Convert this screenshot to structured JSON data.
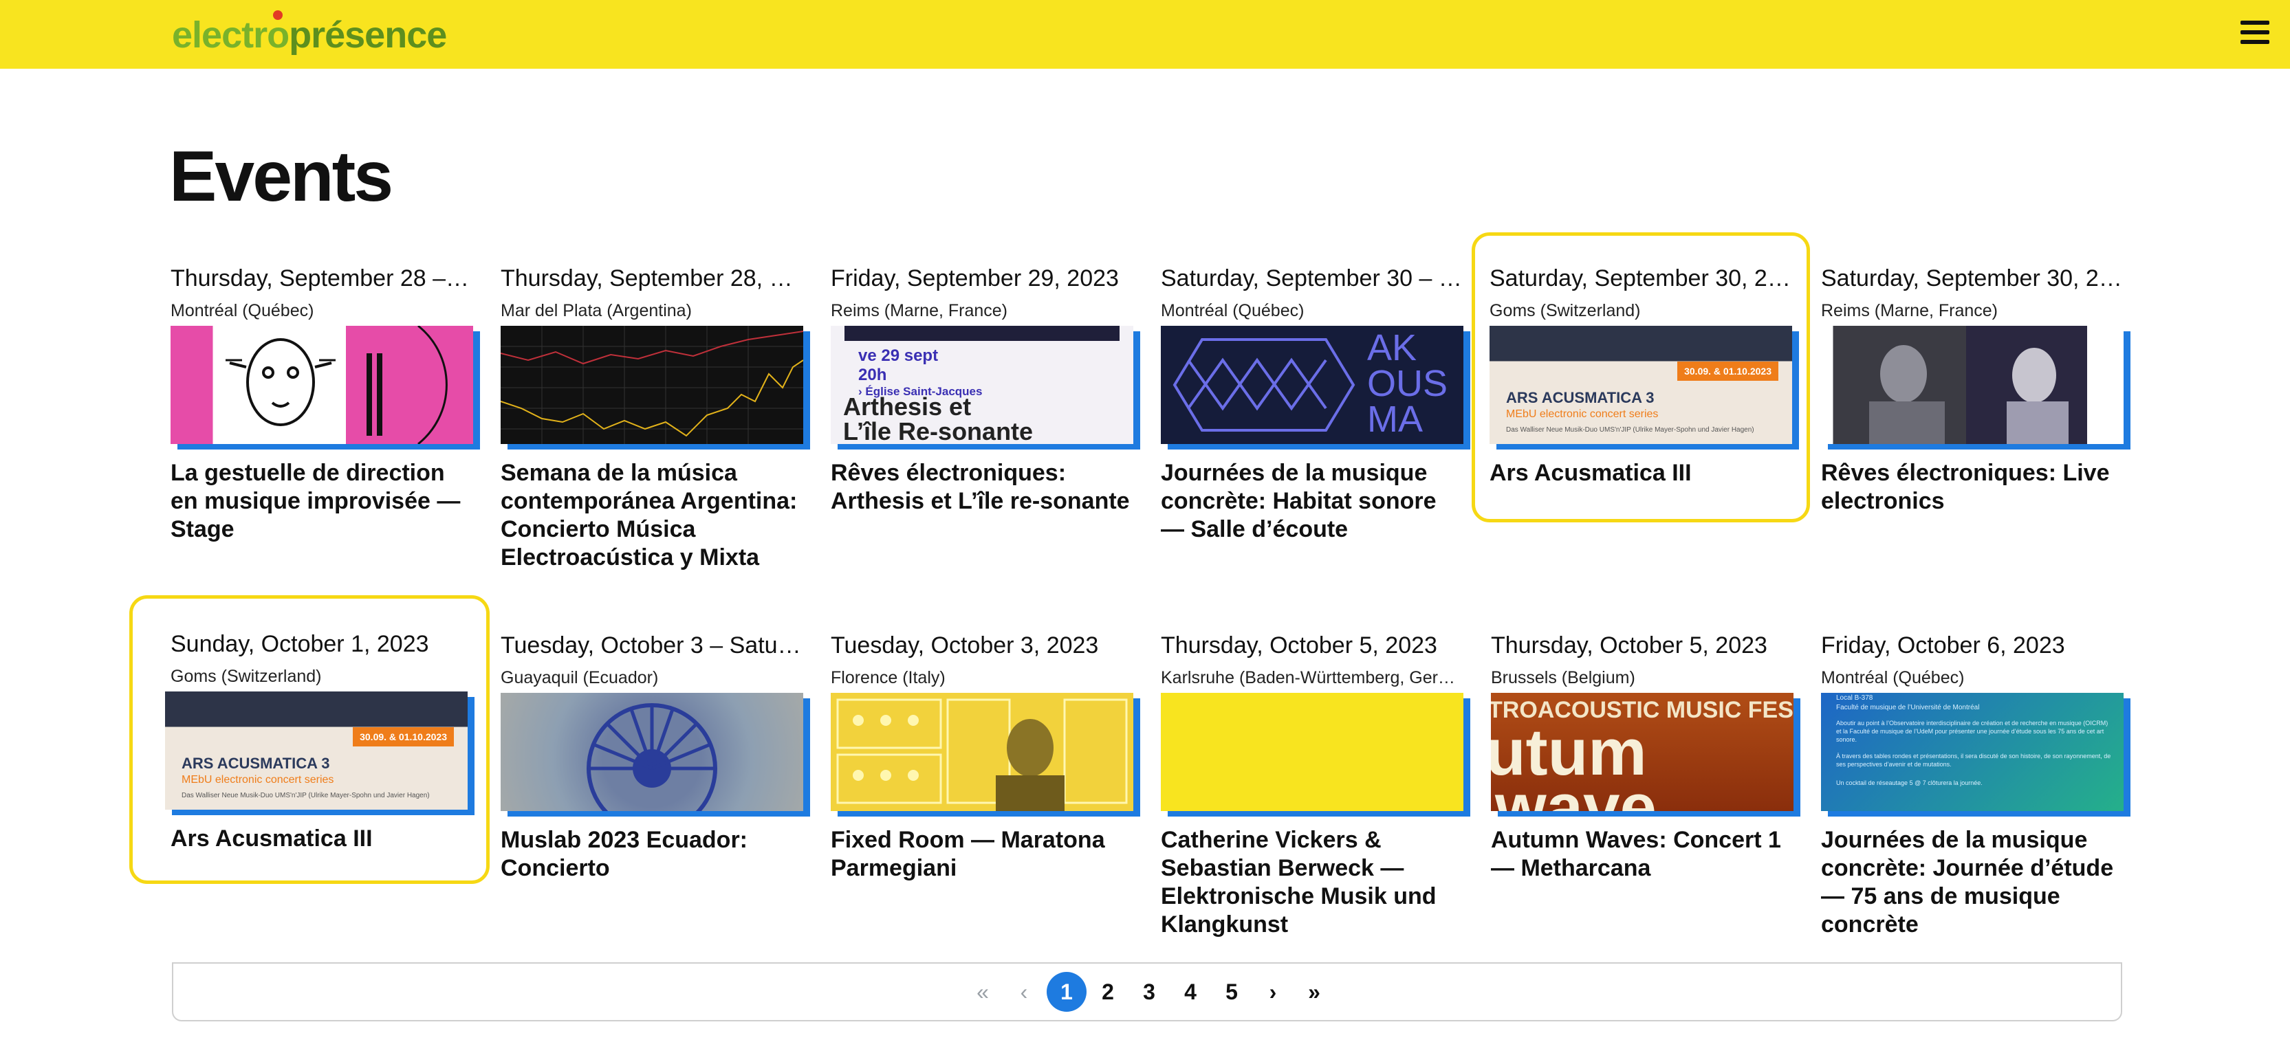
{
  "header": {
    "logo": "electroprésence",
    "menu_icon": "hamburger-menu-icon"
  },
  "page_title": "Events",
  "events": [
    {
      "date": "Thursday, September 28 – …",
      "location": "Montréal (Québec)",
      "title": "La gestuelle de direction en musique improvisée — Stage"
    },
    {
      "date": "Thursday, September 28, 2…",
      "location": "Mar del Plata (Argentina)",
      "title": "Semana de la música contemporánea Argentina: Concierto Música Electroacústica y Mixta"
    },
    {
      "date": "Friday, September 29, 2023",
      "location": "Reims (Marne, France)",
      "title": "Rêves électroniques: Arthesis et L’île re-sonante",
      "image_text": {
        "line1": "ve 29 sept",
        "line2": "20h",
        "line3": "› Église Saint-Jacques",
        "line4": "Arthesis et",
        "line5": "L’île Re-sonante"
      }
    },
    {
      "date": "Saturday, September 30 – …",
      "location": "Montréal (Québec)",
      "title": "Journées de la musique concrète: Habitat sonore — Salle d’écoute",
      "image_text": {
        "line1": "AK",
        "line2": "OUS",
        "line3": "MA"
      }
    },
    {
      "date": "Saturday, September 30, 2…",
      "location": "Goms (Switzerland)",
      "title": "Ars Acusmatica III",
      "image_text": {
        "tag": "30.09. & 01.10.2023",
        "headline": "ARS ACUSMATICA 3",
        "sub": "MEbU electronic concert series",
        "small": "Das Walliser Neue Musik-Duo UMS'n'JIP (Ulrike Mayer-Spohn und Javier Hagen)"
      }
    },
    {
      "date": "Saturday, September 30, 2…",
      "location": "Reims (Marne, France)",
      "title": "Rêves électroniques: Live electronics"
    },
    {
      "date": "Sunday, October 1, 2023",
      "location": "Goms (Switzerland)",
      "title": "Ars Acusmatica III",
      "image_text": {
        "tag": "30.09. & 01.10.2023",
        "headline": "ARS ACUSMATICA 3",
        "sub": "MEbU electronic concert series",
        "small": "Das Walliser Neue Musik-Duo UMS'n'JIP (Ulrike Mayer-Spohn und Javier Hagen)"
      }
    },
    {
      "date": "Tuesday, October 3 – Satur…",
      "location": "Guayaquil (Ecuador)",
      "title": "Muslab 2023 Ecuador: Concierto"
    },
    {
      "date": "Tuesday, October 3, 2023",
      "location": "Florence (Italy)",
      "title": "Fixed Room — Maratona Parmegiani"
    },
    {
      "date": "Thursday, October 5, 2023",
      "location": "Karlsruhe (Baden-Württemberg, Ger…",
      "title": "Catherine Vickers & Sebastian Berweck — Elektronische Musik und Klangkunst"
    },
    {
      "date": "Thursday, October 5, 2023",
      "location": "Brussels (Belgium)",
      "title": "Autumn Waves: Concert 1 — Metharcana",
      "image_text": {
        "line1": "TROACOUSTIC MUSIC FES",
        "line2": "utum",
        "line3": "wave"
      }
    },
    {
      "date": "Friday, October 6, 2023",
      "location": "Montréal (Québec)",
      "title": "Journées de la musique concrète: Journée d’étude — 75 ans de musique concrète",
      "image_text": {
        "line1": "Local B-378",
        "line2": "Faculté de musique de l’Université de Montréal",
        "line3": "Aboutir au point à l’Observatoire interdisciplinaire de création et de recherche en musique (OICRM) et la Faculté de musique de l’UdeM pour présenter une journée d’étude sous les 75 ans de cet art sonore.",
        "line4": "À travers des tables rondes et présentations, il sera discuté de son histoire, de son rayonnement, de ses perspectives d’avenir et de mutations.",
        "line5": "Un cocktail de réseautage 5 @ 7 clôturera la journée."
      }
    }
  ],
  "pagination": {
    "first": "«",
    "prev": "‹",
    "pages": [
      "1",
      "2",
      "3",
      "4",
      "5"
    ],
    "current": "1",
    "next": "›",
    "last": "»"
  },
  "colors": {
    "header_bg": "#f8e41f",
    "accent_blue": "#1e7be0",
    "focus_ring": "#f6d814",
    "logo_green": "#79b22b"
  }
}
